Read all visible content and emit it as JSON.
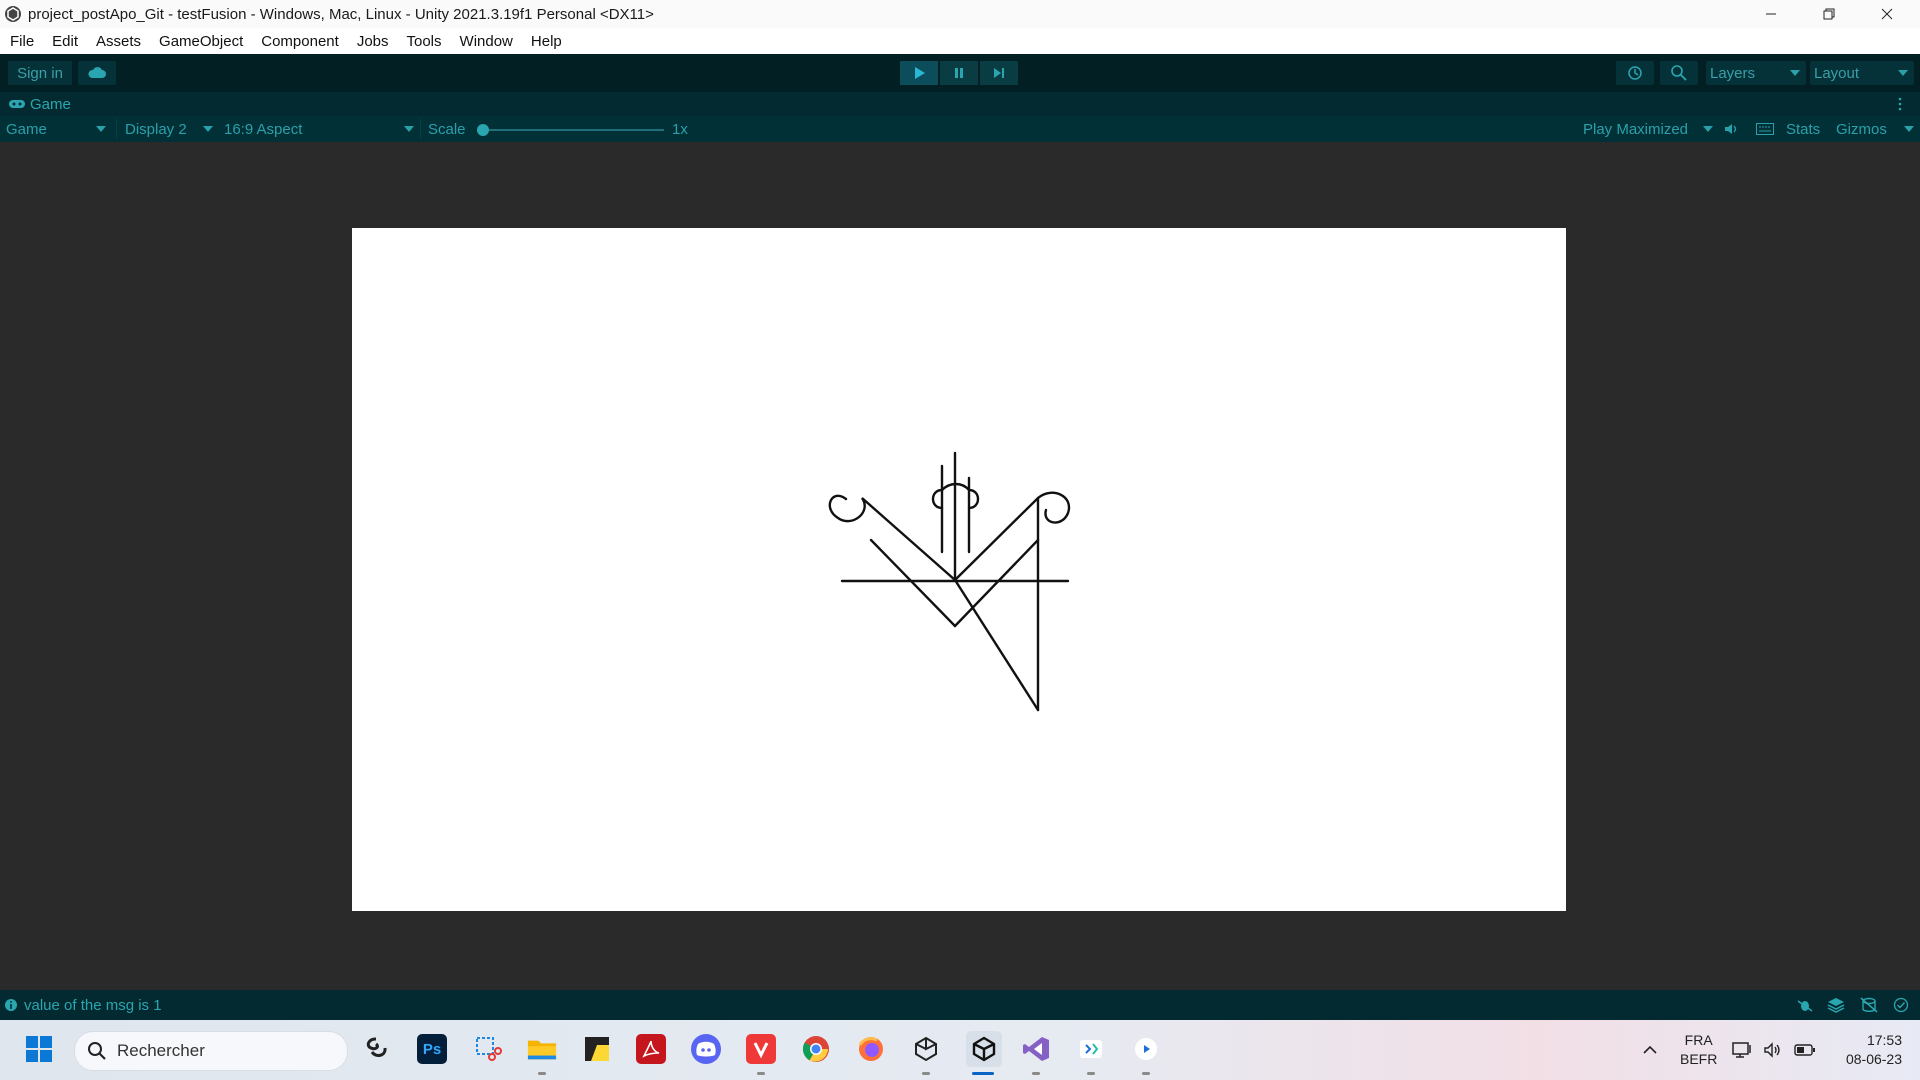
{
  "window": {
    "title": "project_postApo_Git - testFusion - Windows, Mac, Linux - Unity 2021.3.19f1 Personal <DX11>"
  },
  "menu": [
    "File",
    "Edit",
    "Assets",
    "GameObject",
    "Component",
    "Jobs",
    "Tools",
    "Window",
    "Help"
  ],
  "toolbar": {
    "sign_in": "Sign in",
    "layers": "Layers",
    "layout": "Layout"
  },
  "game_tab": {
    "label": "Game"
  },
  "game_toolbar": {
    "mode": "Game",
    "display": "Display 2",
    "aspect": "16:9 Aspect",
    "scale_label": "Scale",
    "scale_value": "1x",
    "play_mode": "Play Maximized",
    "stats": "Stats",
    "gizmos": "Gizmos"
  },
  "status": {
    "message": "value of the msg is 1"
  },
  "taskbar": {
    "search_placeholder": "Rechercher",
    "language": "FRA",
    "keyboard": "BEFR",
    "time": "17:53",
    "date": "08-06-23",
    "apps": [
      "windows-start",
      "copilot-app",
      "photoshop",
      "snipping-tool",
      "file-explorer",
      "sticky-notes",
      "acrobat",
      "discord",
      "vivaldi",
      "chrome",
      "firefox",
      "unity-hub",
      "unity-editor",
      "visual-studio",
      "vs-code-insiders",
      "media-player"
    ]
  },
  "colors": {
    "toolbar_bg": "#021f24",
    "accent": "#2aa6b0",
    "game_bg": "#2a2a2a",
    "canvas_bg": "#ffffff"
  }
}
